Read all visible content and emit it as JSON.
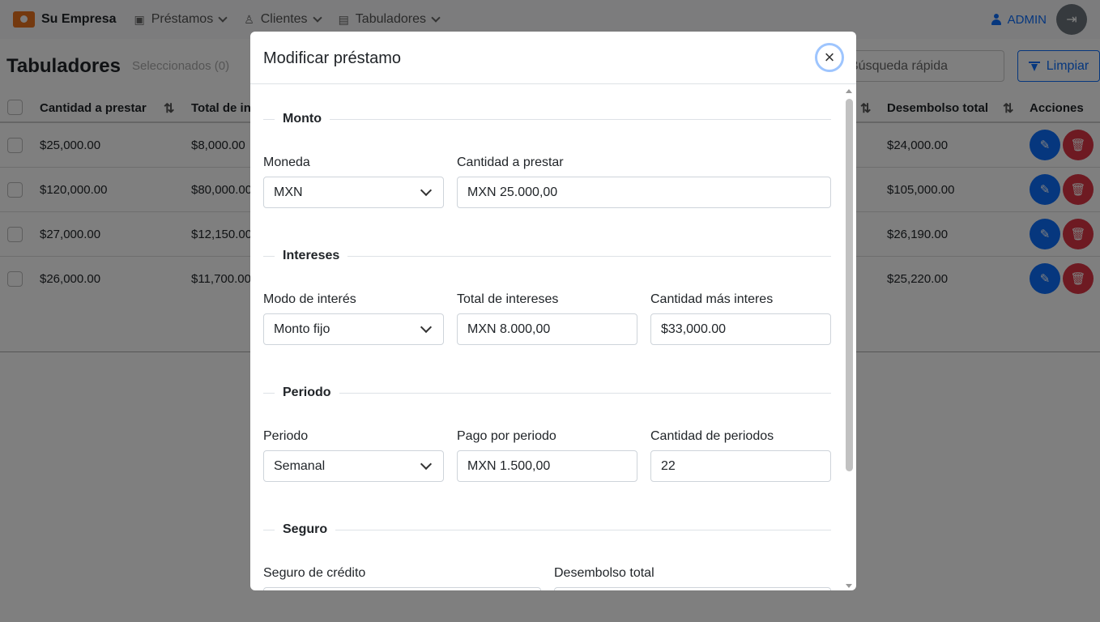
{
  "navbar": {
    "brand": "Su Empresa",
    "items": [
      {
        "label": "Préstamos",
        "icon": "money-icon"
      },
      {
        "label": "Clientes",
        "icon": "person-icon"
      },
      {
        "label": "Tabuladores",
        "icon": "table-icon"
      }
    ],
    "user": "ADMIN"
  },
  "page": {
    "title": "Tabuladores",
    "selected": "Seleccionados (0)",
    "search_placeholder": "Búsqueda rápida",
    "clear_label": "Limpiar"
  },
  "table": {
    "headers": {
      "amount": "Cantidad a prestar",
      "interest": "Total de in",
      "disbursement": "Desembolso total",
      "actions": "Acciones"
    },
    "rows": [
      {
        "amount": "$25,000.00",
        "interest": "$8,000.00",
        "disbursement": "$24,000.00"
      },
      {
        "amount": "$120,000.00",
        "interest": "$80,000.00",
        "disbursement": "$105,000.00"
      },
      {
        "amount": "$27,000.00",
        "interest": "$12,150.00",
        "disbursement": "$26,190.00"
      },
      {
        "amount": "$26,000.00",
        "interest": "$11,700.00",
        "disbursement": "$25,220.00"
      }
    ]
  },
  "modal": {
    "title": "Modificar préstamo",
    "sections": {
      "monto": "Monto",
      "intereses": "Intereses",
      "periodo": "Periodo",
      "seguro": "Seguro"
    },
    "fields": {
      "moneda": {
        "label": "Moneda",
        "value": "MXN"
      },
      "cantidad": {
        "label": "Cantidad a prestar",
        "value": "MXN 25.000,00"
      },
      "modo": {
        "label": "Modo de interés",
        "value": "Monto fijo"
      },
      "total_intereses": {
        "label": "Total de intereses",
        "value": "MXN 8.000,00"
      },
      "cantidad_mas": {
        "label": "Cantidad más interes",
        "value": "$33,000.00"
      },
      "periodo": {
        "label": "Periodo",
        "value": "Semanal"
      },
      "pago": {
        "label": "Pago por periodo",
        "value": "MXN 1.500,00"
      },
      "num_periodos": {
        "label": "Cantidad de periodos",
        "value": "22"
      },
      "seguro_credito": {
        "label": "Seguro de crédito",
        "value": ""
      },
      "desembolso": {
        "label": "Desembolso total",
        "value": ""
      }
    }
  }
}
